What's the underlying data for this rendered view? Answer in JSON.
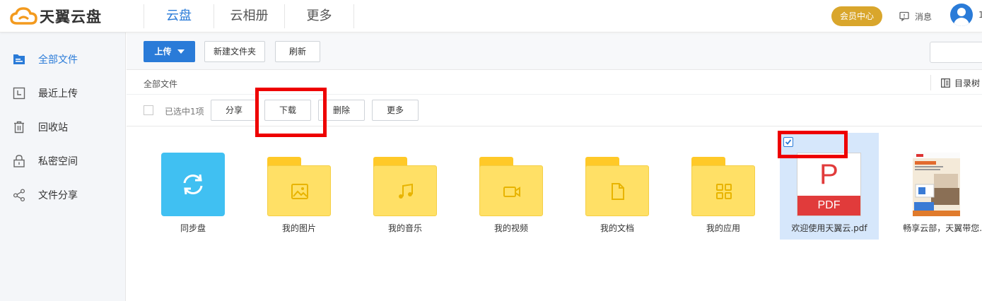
{
  "app": {
    "logo_text": "天翼云盘",
    "brand_color": "#2a7bd8"
  },
  "nav": {
    "items": [
      "云盘",
      "云相册",
      "更多"
    ],
    "active": 0
  },
  "header": {
    "vip_label": "会员中心",
    "vip_color": "#d9a62c",
    "message_label": "消息",
    "user_initial": "1"
  },
  "sidebar": {
    "items": [
      {
        "label": "全部文件",
        "icon": "all-files-icon",
        "active": true
      },
      {
        "label": "最近上传",
        "icon": "recent-upload-icon",
        "active": false
      },
      {
        "label": "回收站",
        "icon": "trash-icon",
        "active": false
      },
      {
        "label": "私密空间",
        "icon": "lock-icon",
        "active": false
      },
      {
        "label": "文件分享",
        "icon": "share-icon",
        "active": false
      }
    ]
  },
  "toolbar": {
    "upload_label": "上传",
    "new_folder_label": "新建文件夹",
    "refresh_label": "刷新"
  },
  "pathbar": {
    "breadcrumb": "全部文件",
    "tree_label": "目录树"
  },
  "selection": {
    "count_text": "已选中1项",
    "share_label": "分享",
    "download_label": "下载",
    "delete_label": "删除",
    "more_label": "更多"
  },
  "files": [
    {
      "name": "同步盘",
      "kind": "sync",
      "icon": "sync-icon"
    },
    {
      "name": "我的图片",
      "kind": "folder",
      "icon": "image-icon"
    },
    {
      "name": "我的音乐",
      "kind": "folder",
      "icon": "music-icon"
    },
    {
      "name": "我的视频",
      "kind": "folder",
      "icon": "video-icon"
    },
    {
      "name": "我的文档",
      "kind": "folder",
      "icon": "document-icon"
    },
    {
      "name": "我的应用",
      "kind": "folder",
      "icon": "apps-icon"
    },
    {
      "name": "欢迎使用天翼云.pdf",
      "kind": "pdf",
      "icon": "pdf-icon",
      "selected": true,
      "pdf_letter": "P",
      "pdf_band": "PDF"
    },
    {
      "name": "畅享云部，天翼带您...",
      "kind": "image",
      "icon": "image-thumbnail"
    }
  ]
}
